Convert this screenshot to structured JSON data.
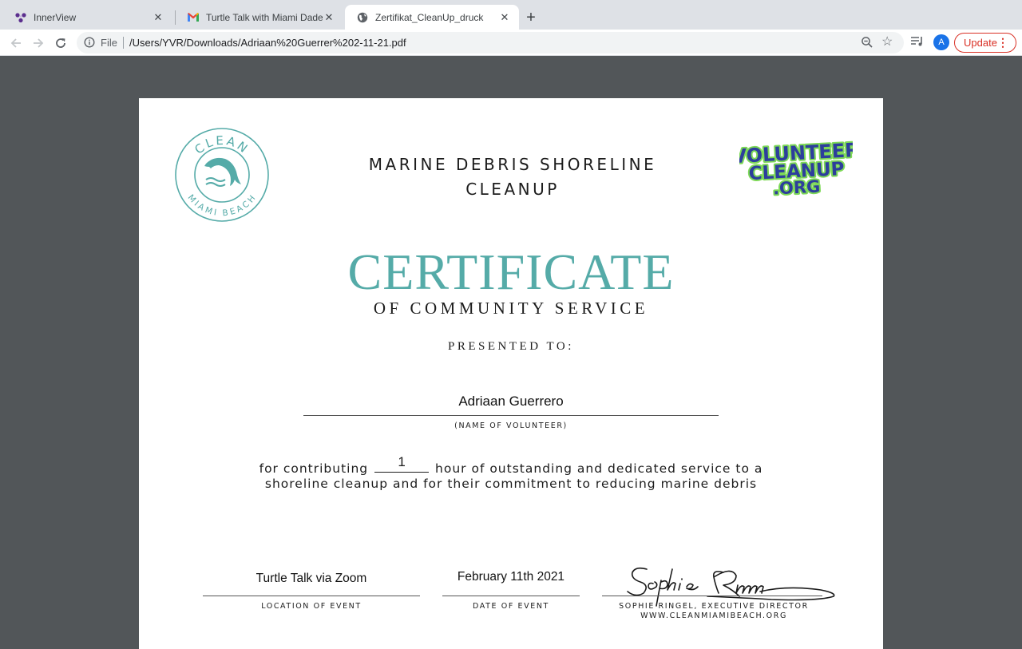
{
  "browser": {
    "tabs": [
      {
        "title": "InnerView",
        "icon": "innerview-icon",
        "active": false
      },
      {
        "title": "Turtle Talk with Miami Dade Se",
        "icon": "gmail-icon",
        "active": false
      },
      {
        "title": "Zertifikat_CleanUp_druck",
        "icon": "globe-icon",
        "active": true
      }
    ],
    "new_tab": "+",
    "close_glyph": "✕",
    "address": {
      "scheme_label": "File",
      "url": "/Users/YVR/Downloads/Adriaan%20Guerrer%202-11-21.pdf"
    },
    "profile_initial": "A",
    "update_label": "Update",
    "menu_glyph": "⋮",
    "colors": {
      "accent": "#1a73e8",
      "update": "#d93025"
    }
  },
  "certificate": {
    "logo_left": {
      "top_text": "CLEAN",
      "bottom_text": "MIAMI BEACH"
    },
    "logo_right": {
      "lines": [
        "VOLUNTEER",
        "CLEANUP",
        ".ORG"
      ]
    },
    "event_title_line1": "MARINE DEBRIS SHORELINE",
    "event_title_line2": "CLEANUP",
    "title": "CERTIFICATE",
    "subtitle": "OF COMMUNITY SERVICE",
    "presented_to": "PRESENTED TO:",
    "volunteer_name": "Adriaan Guerrero",
    "name_caption": "(NAME OF VOLUNTEER)",
    "service_prefix": "for contributing",
    "hours": "1",
    "service_suffix": "hour of outstanding and dedicated service to a",
    "service_line2": "shoreline cleanup and for their commitment to reducing marine debris",
    "location": "Turtle Talk via Zoom",
    "location_caption": "LOCATION OF EVENT",
    "date": "February 11th 2021",
    "date_caption": "DATE OF EVENT",
    "signer_caption": "SOPHIE RINGEL, EXECUTIVE DIRECTOR",
    "website": "WWW.CLEANMIAMIBEACH.ORG",
    "accent_color": "#55aba8"
  }
}
